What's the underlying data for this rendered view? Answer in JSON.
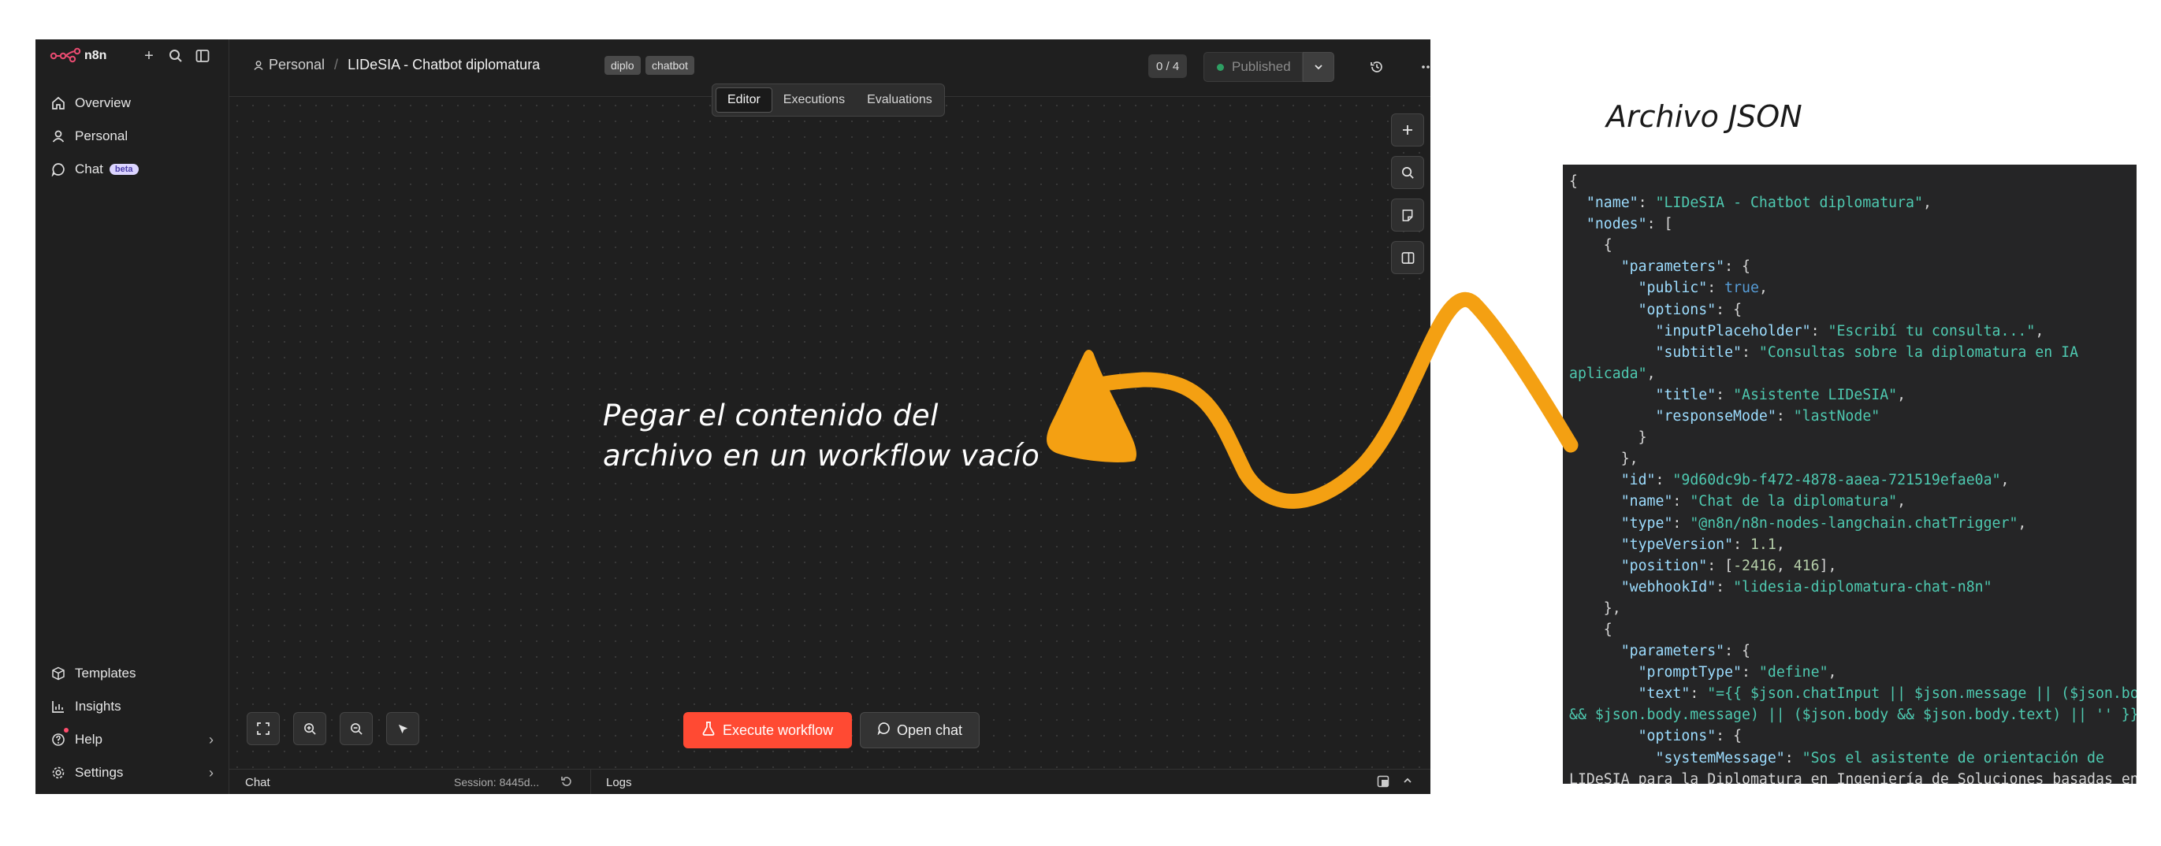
{
  "app": {
    "logo_text": "n8n",
    "sidebar": {
      "items": [
        {
          "label": "Overview",
          "icon": "home-icon"
        },
        {
          "label": "Personal",
          "icon": "user-icon"
        },
        {
          "label": "Chat",
          "icon": "chat-icon",
          "badge": "beta"
        }
      ],
      "bottom_items": [
        {
          "label": "Templates",
          "icon": "box-icon"
        },
        {
          "label": "Insights",
          "icon": "chart-icon"
        },
        {
          "label": "Help",
          "icon": "help-icon"
        },
        {
          "label": "Settings",
          "icon": "gear-icon"
        }
      ]
    },
    "header": {
      "project": "Personal",
      "separator": "/",
      "workflow_title": "LIDeSIA - Chatbot diplomatura",
      "tags": [
        "diplo",
        "chatbot"
      ],
      "counter": "0 / 4",
      "publish_label": "Published"
    },
    "tabs": [
      {
        "label": "Editor",
        "active": true
      },
      {
        "label": "Executions",
        "active": false
      },
      {
        "label": "Evaluations",
        "active": false
      }
    ],
    "canvas": {
      "execute_label": "Execute workflow",
      "open_chat_label": "Open chat"
    },
    "bottom_bar": {
      "chat_label": "Chat",
      "session": "Session: 8445d...",
      "logs_label": "Logs"
    }
  },
  "annotation": {
    "line1": "Pegar el contenido del",
    "line2": "archivo en un workflow vacío",
    "json_title": "Archivo JSON"
  },
  "json_file_lines": [
    "{",
    "  \"name\": \"LIDeSIA - Chatbot diplomatura\",",
    "  \"nodes\": [",
    "    {",
    "      \"parameters\": {",
    "        \"public\": true,",
    "        \"options\": {",
    "          \"inputPlaceholder\": \"Escribí tu consulta...\",",
    "          \"subtitle\": \"Consultas sobre la diplomatura en IA",
    "aplicada\",",
    "          \"title\": \"Asistente LIDeSIA\",",
    "          \"responseMode\": \"lastNode\"",
    "        }",
    "      },",
    "      \"id\": \"9d60dc9b-f472-4878-aaea-721519efae0a\",",
    "      \"name\": \"Chat de la diplomatura\",",
    "      \"type\": \"@n8n/n8n-nodes-langchain.chatTrigger\",",
    "      \"typeVersion\": 1.1,",
    "      \"position\": [-2416, 416],",
    "      \"webhookId\": \"lidesia-diplomatura-chat-n8n\"",
    "    },",
    "    {",
    "      \"parameters\": {",
    "        \"promptType\": \"define\",",
    "        \"text\": \"={{ $json.chatInput || $json.message || ($json.body",
    "&& $json.body.message) || ($json.body && $json.body.text) || '' }}\",",
    "        \"options\": {",
    "          \"systemMessage\": \"Sos el asistente de orientación de",
    "LIDeSIA para la Diplomatura en Ingeniería de Soluciones basadas en"
  ],
  "colors": {
    "accent_orange": "#f4a012",
    "execute_red": "#ff4a33",
    "brand_pink": "#ea4b71"
  }
}
